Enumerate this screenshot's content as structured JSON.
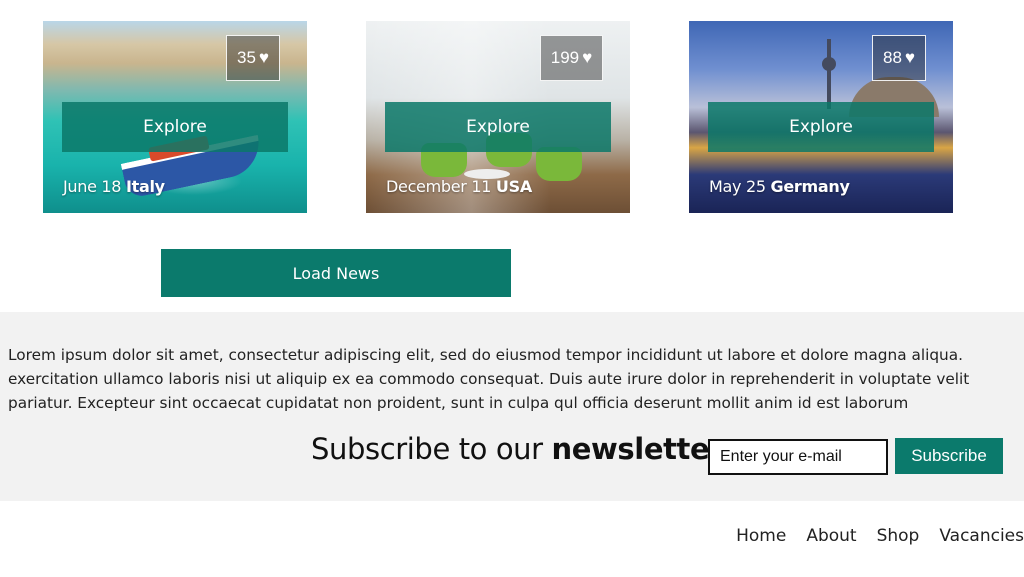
{
  "cards": [
    {
      "likes": "35",
      "heart": "♥",
      "explore_label": "Explore",
      "date": "June 18",
      "place": "Italy"
    },
    {
      "likes": "199",
      "heart": "♥",
      "explore_label": "Explore",
      "date": "December 11",
      "place": "USA"
    },
    {
      "likes": "88",
      "heart": "♥",
      "explore_label": "Explore",
      "date": "May 25",
      "place": "Germany"
    }
  ],
  "load_news_label": "Load News",
  "lorem": [
    "Lorem ipsum dolor sit amet, consectetur adipiscing elit, sed do eiusmod tempor incididunt ut labore et dolore magna aliqua.",
    "exercitation ullamco laboris nisi ut aliquip ex ea commodo consequat. Duis aute irure dolor in reprehenderit in voluptate velit",
    "pariatur. Excepteur sint occaecat cupidatat non proident, sunt in culpa qul officia deserunt mollit anim id est laborum"
  ],
  "newsletter": {
    "heading_prefix": "Subscribe to our",
    "heading_bold": "newsletter",
    "email_placeholder": "Enter your e-mail",
    "subscribe_label": "Subscribe"
  },
  "footer_nav": [
    "Home",
    "About",
    "Shop",
    "Vacancies"
  ],
  "colors": {
    "accent": "#0b7a6c",
    "section_bg": "#f2f2f2"
  }
}
